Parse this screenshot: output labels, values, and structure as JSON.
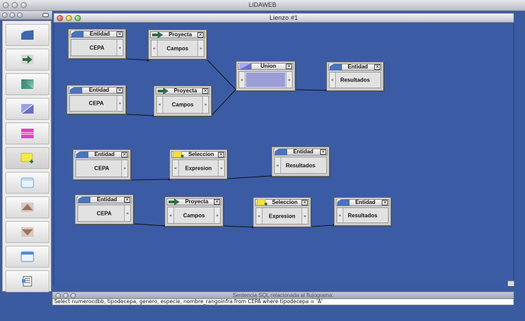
{
  "window": {
    "title": "LIDAWEB"
  },
  "canvas": {
    "title": "Lienzo #1"
  },
  "palette": {
    "tools": [
      {
        "icon": "entity-tool-icon"
      },
      {
        "icon": "project-tool-icon"
      },
      {
        "icon": "select-tool-icon"
      },
      {
        "icon": "union-tool-icon"
      },
      {
        "icon": "difference-tool-icon"
      },
      {
        "icon": "selection-tool-icon"
      },
      {
        "icon": "blank-tool-icon"
      },
      {
        "icon": "sort-ascending-tool-icon"
      },
      {
        "icon": "sort-descending-tool-icon"
      },
      {
        "icon": "window-tool-icon"
      },
      {
        "icon": "sql-tool-icon"
      }
    ]
  },
  "flow": {
    "row1": {
      "entity_a": {
        "title": "Entidad",
        "label": "CEPA"
      },
      "project_a": {
        "title": "Proyecta",
        "label": "Campos"
      },
      "entity_b": {
        "title": "Entidad",
        "label": "CEPA"
      },
      "project_b": {
        "title": "Proyecta",
        "label": "Campos"
      },
      "union": {
        "title": "Union"
      },
      "result": {
        "title": "Entidad",
        "label": "Resultados"
      }
    },
    "row2": {
      "entity": {
        "title": "Entidad",
        "label": "CEPA"
      },
      "selection": {
        "title": "Seleccion",
        "label": "Expresion"
      },
      "result": {
        "title": "Entidad",
        "label": "Resultados"
      }
    },
    "row3": {
      "entity": {
        "title": "Entidad",
        "label": "CEPA"
      },
      "project": {
        "title": "Proyecta",
        "label": "Campos"
      },
      "selection": {
        "title": "Seleccion",
        "label": "Expresion"
      },
      "result": {
        "title": "Entidad",
        "label": "Resultados"
      }
    },
    "port_in": "«",
    "port_out": "»",
    "close_glyph": "✕"
  },
  "sql_panel": {
    "title": "Sentencia SQL relacionada al flujograma:",
    "query": "Select numerocdbb, tipodecepa, genero, especie, nombre_rangoinfra from CEPA where tipodecepa = 'A'"
  },
  "colors": {
    "canvas_bg": "#3b5ca4",
    "union_fill": "#9b9ed6",
    "entity_icon": "#4a73b8",
    "project_arrow": "#2f6b45",
    "selection_icon": "#f0e040"
  }
}
